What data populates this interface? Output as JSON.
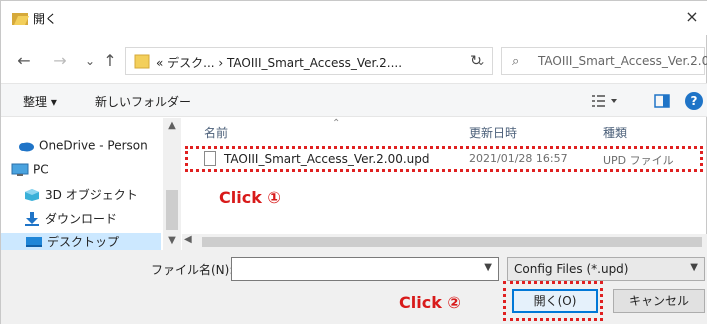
{
  "window": {
    "title": "開く",
    "close_glyph": "×"
  },
  "address": {
    "back_glyph": "←",
    "forward_glyph": "→",
    "recent_glyph": "⌄",
    "up_glyph": "↑",
    "path": "« デスク... › TAOIII_Smart_Access_Ver.2....",
    "dropdown_glyph": "⌄",
    "refresh_glyph": "↻",
    "search_glyph": "⌕",
    "search_placeholder": "TAOIII_Smart_Access_Ver.2.0..."
  },
  "toolbar": {
    "organize": "整理 ▾",
    "new_folder": "新しいフォルダー",
    "help": "?"
  },
  "nav": {
    "items": [
      {
        "label": "OneDrive - Person",
        "icon": "cloud-icon"
      },
      {
        "label": "PC",
        "icon": "pc-icon"
      },
      {
        "label": "3D オブジェクト",
        "icon": "3d-objects-icon"
      },
      {
        "label": "ダウンロード",
        "icon": "download-icon"
      },
      {
        "label": "デスクトップ",
        "icon": "desktop-icon"
      }
    ]
  },
  "columns": {
    "name": "名前",
    "date": "更新日時",
    "type": "種類"
  },
  "files": [
    {
      "name": "TAOIII_Smart_Access_Ver.2.00.upd",
      "date": "2021/01/28 16:57",
      "type": "UPD ファイル"
    }
  ],
  "bottom": {
    "filename_label": "ファイル名(N):",
    "filename_value": "",
    "filetype": "Config Files (*.upd)",
    "open_button": "開く(O)",
    "cancel_button": "キャンセル"
  },
  "annotations": {
    "click1": "Click ①",
    "click2": "Click ②",
    "color": "#d81a1a"
  }
}
